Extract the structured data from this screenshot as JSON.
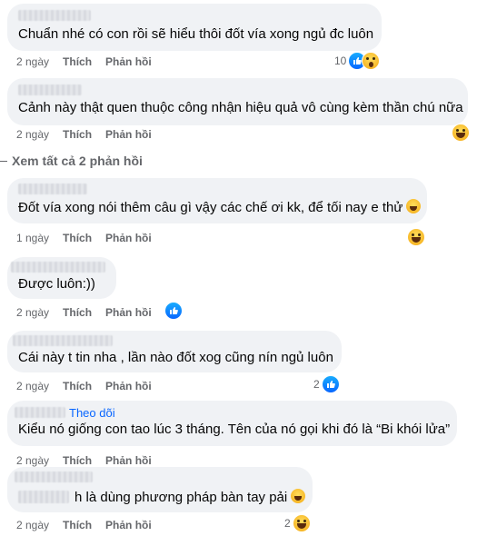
{
  "comments": [
    {
      "text": "Chuẩn nhé có con rồi sẽ hiểu thôi đốt vía xong ngủ đc luôn",
      "time": "2 ngày",
      "like": "Thích",
      "reply": "Phản hồi",
      "reaction_count": "10",
      "reactions": [
        "like-icon",
        "wow-icon"
      ]
    },
    {
      "text": "Cảnh này thật quen thuộc công nhận hiệu quả vô cùng kèm thần chú nữa",
      "time": "2 ngày",
      "like": "Thích",
      "reply": "Phản hồi",
      "reactions": [
        "haha-icon"
      ]
    },
    {
      "text": "Đốt vía xong nói thêm câu gì vậy các chế ơi kk, để tối nay e thử",
      "time": "1 ngày",
      "like": "Thích",
      "reply": "Phản hồi",
      "reactions": [
        "haha-icon"
      ]
    },
    {
      "text": "Được luôn:))",
      "time": "2 ngày",
      "like": "Thích",
      "reply": "Phản hồi",
      "reactions": [
        "like-icon"
      ]
    },
    {
      "text": "Cái này t tin nha , lần nào đốt xog cũng nín ngủ luôn",
      "time": "2 ngày",
      "like": "Thích",
      "reply": "Phản hồi",
      "reaction_count": "2",
      "reactions": [
        "like-icon"
      ]
    },
    {
      "text": "Kiểu nó giống con tao lúc 3 tháng. Tên của nó gọi khi đó là “Bi khói lửa”",
      "follow": "Theo dõi",
      "time": "2 ngày",
      "like": "Thích",
      "reply": "Phản hồi"
    },
    {
      "text": "h là dùng phương pháp bàn tay pải",
      "time": "2 ngày",
      "like": "Thích",
      "reply": "Phản hồi",
      "reaction_count": "2",
      "reactions": [
        "haha-icon"
      ]
    }
  ],
  "view_replies": "Xem tất cả 2 phản hồi",
  "colors": {
    "bubble": "#f0f2f5",
    "meta": "#65676b",
    "link": "#0866ff",
    "text": "#050505"
  }
}
